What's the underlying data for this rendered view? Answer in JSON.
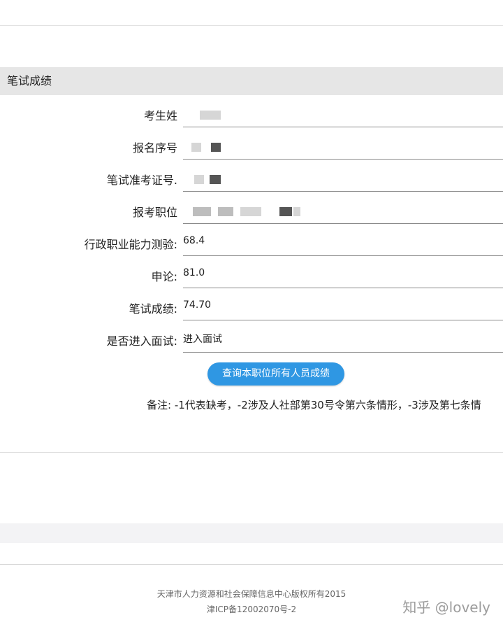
{
  "section": {
    "title": "笔试成绩"
  },
  "form": {
    "rows": [
      {
        "label": "考生姓",
        "value": ""
      },
      {
        "label": "报名序号",
        "value": ""
      },
      {
        "label": "笔试准考证号.",
        "value": ""
      },
      {
        "label": "报考职位",
        "value": ""
      },
      {
        "label": "行政职业能力测验:",
        "value": "68.4"
      },
      {
        "label": "申论:",
        "value": "81.0"
      },
      {
        "label": "笔试成绩:",
        "value": "74.70"
      },
      {
        "label": "是否进入面试:",
        "value": "进入面试"
      }
    ]
  },
  "actions": {
    "query_label": "查询本职位所有人员成绩"
  },
  "note": {
    "text": "备注: -1代表缺考，-2涉及人社部第30号令第六条情形，-3涉及第七条情"
  },
  "footer": {
    "copyright": "天津市人力资源和社会保障信息中心版权所有2015",
    "icp": "津ICP备12002070号-2"
  },
  "watermark": {
    "text": "知乎 @lovely"
  },
  "colors": {
    "accent": "#2f97e3",
    "header_bg": "#e6e6e6"
  }
}
